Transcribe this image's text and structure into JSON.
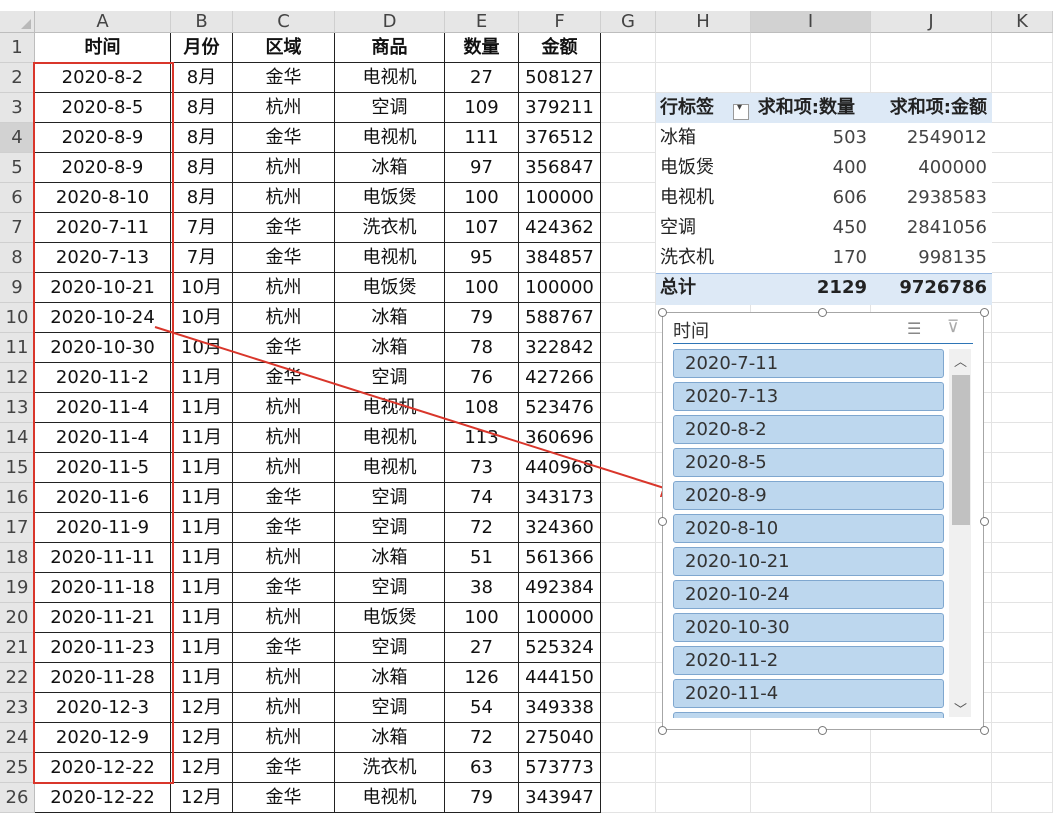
{
  "columns": [
    "A",
    "B",
    "C",
    "D",
    "E",
    "F",
    "G",
    "H",
    "I",
    "J",
    "K"
  ],
  "rows": [
    "1",
    "2",
    "3",
    "4",
    "5",
    "6",
    "7",
    "8",
    "9",
    "10",
    "11",
    "12",
    "13",
    "14",
    "15",
    "16",
    "17",
    "18",
    "19",
    "20",
    "21",
    "22",
    "23",
    "24",
    "25",
    "26"
  ],
  "table": {
    "headers": [
      "时间",
      "月份",
      "区域",
      "商品",
      "数量",
      "金额"
    ],
    "rows": [
      [
        "2020-8-2",
        "8月",
        "金华",
        "电视机",
        "27",
        "508127"
      ],
      [
        "2020-8-5",
        "8月",
        "杭州",
        "空调",
        "109",
        "379211"
      ],
      [
        "2020-8-9",
        "8月",
        "金华",
        "电视机",
        "111",
        "376512"
      ],
      [
        "2020-8-9",
        "8月",
        "杭州",
        "冰箱",
        "97",
        "356847"
      ],
      [
        "2020-8-10",
        "8月",
        "杭州",
        "电饭煲",
        "100",
        "100000"
      ],
      [
        "2020-7-11",
        "7月",
        "金华",
        "洗衣机",
        "107",
        "424362"
      ],
      [
        "2020-7-13",
        "7月",
        "金华",
        "电视机",
        "95",
        "384857"
      ],
      [
        "2020-10-21",
        "10月",
        "杭州",
        "电饭煲",
        "100",
        "100000"
      ],
      [
        "2020-10-24",
        "10月",
        "杭州",
        "冰箱",
        "79",
        "588767"
      ],
      [
        "2020-10-30",
        "10月",
        "金华",
        "冰箱",
        "78",
        "322842"
      ],
      [
        "2020-11-2",
        "11月",
        "金华",
        "空调",
        "76",
        "427266"
      ],
      [
        "2020-11-4",
        "11月",
        "杭州",
        "电视机",
        "108",
        "523476"
      ],
      [
        "2020-11-4",
        "11月",
        "杭州",
        "电视机",
        "113",
        "360696"
      ],
      [
        "2020-11-5",
        "11月",
        "杭州",
        "电视机",
        "73",
        "440968"
      ],
      [
        "2020-11-6",
        "11月",
        "金华",
        "空调",
        "74",
        "343173"
      ],
      [
        "2020-11-9",
        "11月",
        "金华",
        "空调",
        "72",
        "324360"
      ],
      [
        "2020-11-11",
        "11月",
        "杭州",
        "冰箱",
        "51",
        "561366"
      ],
      [
        "2020-11-18",
        "11月",
        "金华",
        "空调",
        "38",
        "492384"
      ],
      [
        "2020-11-21",
        "11月",
        "杭州",
        "电饭煲",
        "100",
        "100000"
      ],
      [
        "2020-11-23",
        "11月",
        "金华",
        "空调",
        "27",
        "525324"
      ],
      [
        "2020-11-28",
        "11月",
        "杭州",
        "冰箱",
        "126",
        "444150"
      ],
      [
        "2020-12-3",
        "12月",
        "杭州",
        "空调",
        "54",
        "349338"
      ],
      [
        "2020-12-9",
        "12月",
        "杭州",
        "冰箱",
        "72",
        "275040"
      ],
      [
        "2020-12-22",
        "12月",
        "金华",
        "洗衣机",
        "63",
        "573773"
      ],
      [
        "2020-12-22",
        "12月",
        "金华",
        "电视机",
        "79",
        "343947"
      ]
    ]
  },
  "pivot": {
    "header": [
      "行标签",
      "求和项:数量",
      "求和项:金额"
    ],
    "rows": [
      [
        "冰箱",
        "503",
        "2549012"
      ],
      [
        "电饭煲",
        "400",
        "400000"
      ],
      [
        "电视机",
        "606",
        "2938583"
      ],
      [
        "空调",
        "450",
        "2841056"
      ],
      [
        "洗衣机",
        "170",
        "998135"
      ]
    ],
    "total": [
      "总计",
      "2129",
      "9726786"
    ]
  },
  "slicer": {
    "title": "时间",
    "items": [
      "2020-7-11",
      "2020-7-13",
      "2020-8-2",
      "2020-8-5",
      "2020-8-9",
      "2020-8-10",
      "2020-10-21",
      "2020-10-24",
      "2020-10-30",
      "2020-11-2",
      "2020-11-4"
    ]
  },
  "colors": {
    "annotation": "#d9362b",
    "pivot_header": "#dde9f6",
    "slicer_item": "#bdd7ee"
  }
}
